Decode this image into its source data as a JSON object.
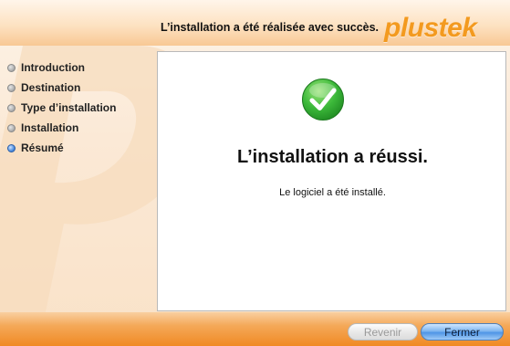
{
  "header": {
    "title": "L’installation a été réalisée avec succès.",
    "logo": "plustek"
  },
  "sidebar": {
    "steps": [
      {
        "label": "Introduction",
        "active": false
      },
      {
        "label": "Destination",
        "active": false
      },
      {
        "label": "Type d’installation",
        "active": false
      },
      {
        "label": "Installation",
        "active": false
      },
      {
        "label": "Résumé",
        "active": true
      }
    ]
  },
  "main": {
    "status_icon": "checkmark-icon",
    "title": "L’installation a réussi.",
    "message": "Le logiciel a été installé."
  },
  "buttons": {
    "back_label": "Revenir",
    "back_enabled": false,
    "close_label": "Fermer"
  },
  "colors": {
    "brand_orange": "#f39a1f",
    "success_green": "#3cb93a",
    "active_step": "#4f8fe0"
  }
}
